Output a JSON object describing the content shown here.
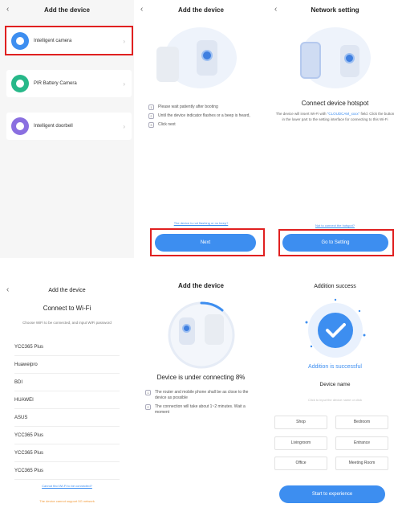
{
  "panel1": {
    "back": "‹",
    "title": "Add the device",
    "items": [
      {
        "label": "Intelligent camera",
        "icon": "camera-icon",
        "color": "#3d8ef0"
      },
      {
        "label": "PIR Battery Camera",
        "icon": "battery-camera-icon",
        "color": "#27b889"
      },
      {
        "label": "Intelligent doorbell",
        "icon": "doorbell-icon",
        "color": "#8a6fe0"
      }
    ]
  },
  "panel2": {
    "back": "‹",
    "title": "Add the device",
    "steps": [
      {
        "num": "1",
        "text": "Please wait patiently after booting"
      },
      {
        "num": "2",
        "text": "Until the device indicator flashes or a beep is heard,"
      },
      {
        "num": "3",
        "text": "Click next"
      }
    ],
    "link": "The device is not flashing or no beep?",
    "next_label": "Next"
  },
  "panel3": {
    "back": "‹",
    "title": "Network setting",
    "heading": "Connect device hotspot",
    "desc_prefix": "The device will insert Wi-Fi with",
    "desc_ssid": "\"CLOUDCAM_xxxx\"",
    "desc_suffix": "field. Click the button in the lower part to the setting interface for connecting to this Wi-Fi",
    "link": "Not to connect the hotspot?",
    "btn_label": "Go to Setting"
  },
  "panel4": {
    "back": "‹",
    "title": "Add the device",
    "heading": "Connect to Wi-Fi",
    "note": "Choose WiFi to be connected, and input WiFi password",
    "networks": [
      "YCC365 Plus",
      "Huaweipro",
      "BDI",
      "HUAWEI",
      "ASUS",
      "YCC365 Plus",
      "YCC365 Plus",
      "YCC365 Plus"
    ],
    "link": "Cannot find Wi-Fi to be connected?",
    "bottom_link": "The device cannot support 5G network"
  },
  "panel5": {
    "title": "Add the device",
    "heading": "Device is under connecting 8%",
    "progress": 8,
    "steps": [
      {
        "num": "1",
        "text": "The router and mobile phone shall be as close to the device as possible"
      },
      {
        "num": "2",
        "text": "The connection will take about 1~2 minutes. Wait a moment"
      }
    ]
  },
  "panel6": {
    "title": "Addition success",
    "success_text": "Addition is successful",
    "device_name_label": "Device name",
    "device_name_placeholder": "Click to input the device name or click",
    "rooms": [
      "Shop",
      "Bedroom",
      "Livingroom",
      "Entrance",
      "Office",
      "Meeting Room"
    ],
    "btn_label": "Start to experience"
  },
  "colors": {
    "accent": "#3d8ef0",
    "highlight": "#e02020",
    "warning": "#f29a3a"
  }
}
